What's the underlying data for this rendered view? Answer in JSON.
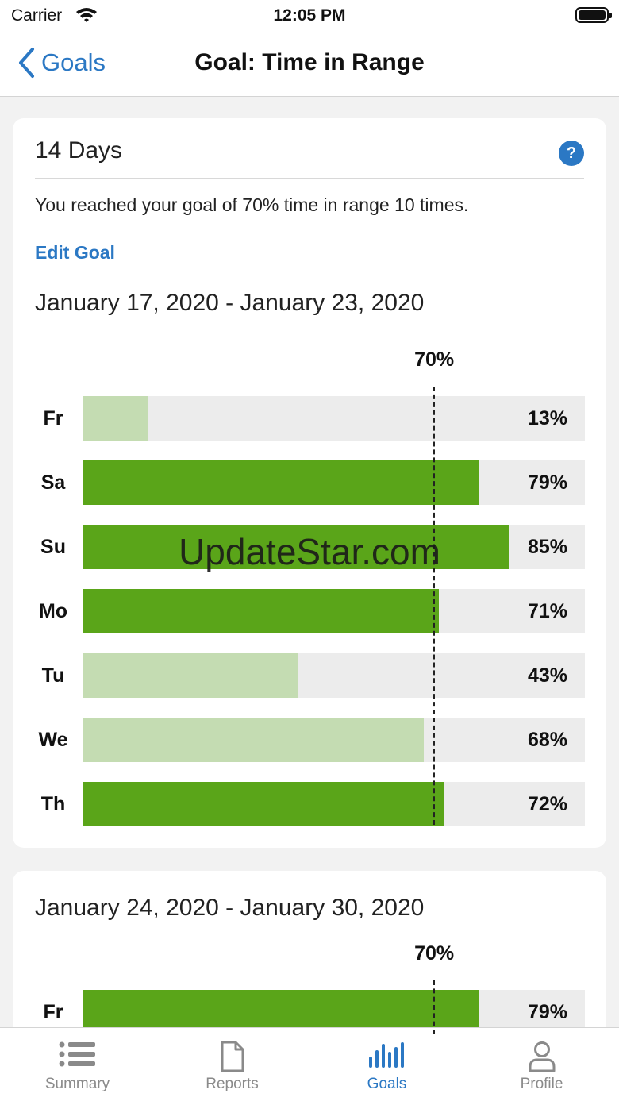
{
  "status_bar": {
    "carrier": "Carrier",
    "time": "12:05 PM"
  },
  "nav": {
    "back_label": "Goals",
    "title": "Goal: Time in Range"
  },
  "summary_card": {
    "header": "14 Days",
    "help_label": "?",
    "summary": "You reached your goal of 70% time in range 10 times.",
    "edit_goal": "Edit Goal"
  },
  "colors": {
    "accent": "#2b78c4",
    "met": "#5aa519",
    "not_met": "#c4dcb2",
    "track": "#ececec"
  },
  "watermark": "UpdateStar.com",
  "chart_data": [
    {
      "type": "bar",
      "title": "January 17, 2020 - January 23, 2020",
      "goal": 70,
      "goal_label": "70%",
      "xlim": [
        0,
        100
      ],
      "categories": [
        "Fr",
        "Sa",
        "Su",
        "Mo",
        "Tu",
        "We",
        "Th"
      ],
      "values": [
        13,
        79,
        85,
        71,
        43,
        68,
        72
      ],
      "value_labels": [
        "13%",
        "79%",
        "85%",
        "71%",
        "43%",
        "68%",
        "72%"
      ]
    },
    {
      "type": "bar",
      "title": "January 24, 2020 - January 30, 2020",
      "goal": 70,
      "goal_label": "70%",
      "xlim": [
        0,
        100
      ],
      "categories": [
        "Fr"
      ],
      "values": [
        79
      ],
      "value_labels": [
        "79%"
      ]
    }
  ],
  "tabs": [
    {
      "label": "Summary",
      "icon": "list-icon",
      "active": false
    },
    {
      "label": "Reports",
      "icon": "document-icon",
      "active": false
    },
    {
      "label": "Goals",
      "icon": "bar-chart-icon",
      "active": true
    },
    {
      "label": "Profile",
      "icon": "person-icon",
      "active": false
    }
  ]
}
